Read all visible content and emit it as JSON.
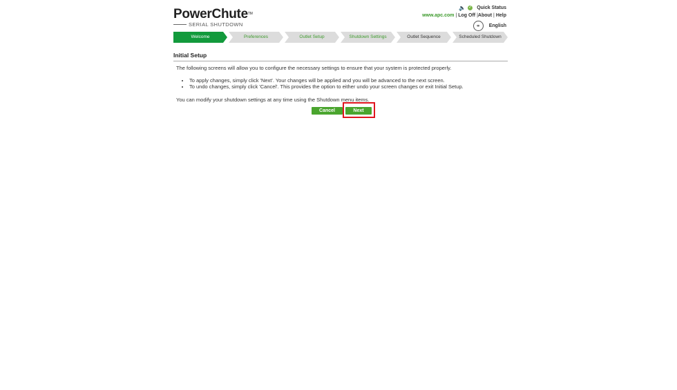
{
  "header": {
    "logo_title": "PowerChute",
    "logo_tm": "TM",
    "logo_subtitle": "SERIAL SHUTDOWN",
    "quick_status_label": "Quick Status",
    "site_link": "www.apc.com",
    "sep1": " | ",
    "logoff_link": "Log Off",
    "sep2": " |",
    "about_link": "About",
    "sep3": " | ",
    "help_link": "Help",
    "language_label": "English"
  },
  "wizard": {
    "steps": [
      {
        "label": "Welcome",
        "active": true
      },
      {
        "label": "Preferences",
        "active": false
      },
      {
        "label": "Outlet Setup",
        "active": false
      },
      {
        "label": "Shutdown Settings",
        "active": false
      },
      {
        "label": "Outlet Sequence",
        "active": false
      },
      {
        "label": "Scheduled Shutdown",
        "active": false
      }
    ]
  },
  "content": {
    "title": "Initial Setup",
    "intro": "The following screens will allow you to configure the necessary settings to ensure that your system is protected properly.",
    "bullets": [
      "To apply changes, simply click 'Next'. Your changes will be applied and you will be advanced to the next screen.",
      "To undo changes, simply click 'Cancel'. This provides the option to either undo your screen changes or exit Initial Setup."
    ],
    "modify_note": "You can modify your shutdown settings at any time using the Shutdown menu items."
  },
  "buttons": {
    "cancel_label": "Cancel",
    "next_label": "Next"
  },
  "colors": {
    "accent_green": "#4aa52e",
    "active_step": "#129a3c",
    "highlight": "#e0141e"
  }
}
